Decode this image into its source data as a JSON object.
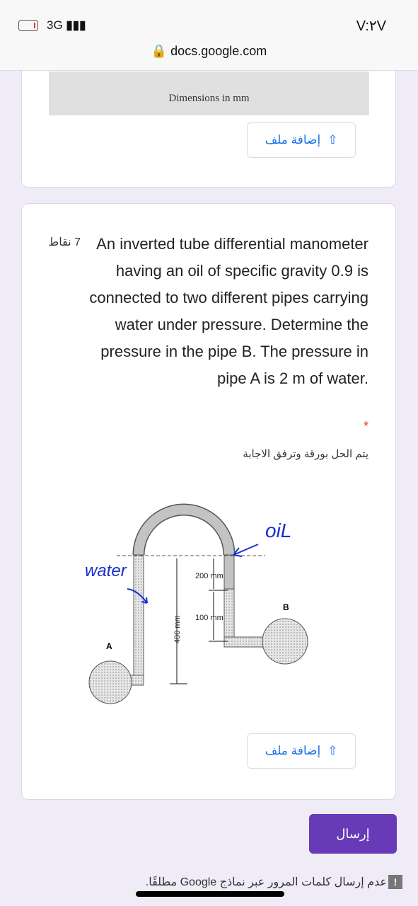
{
  "status_bar": {
    "network": "3G",
    "signal_icon": "signal-bars-icon",
    "battery_icon": "battery-low-icon",
    "time": "V:٢V"
  },
  "browser": {
    "url": "docs.google.com",
    "lock_icon": "lock-icon"
  },
  "prev_card": {
    "image_caption": "Dimensions in mm",
    "upload_label": "إضافة ملف"
  },
  "question_card": {
    "points": "7 نقاط",
    "question": "An inverted tube differential manometer having an oil of specific gravity 0.9 is connected to two different pipes carrying water under pressure. Determine the pressure in the pipe B. The pressure in pipe A is 2 m of water.",
    "required_mark": "*",
    "description": "يتم الحل بورقة وترفق الاجابة",
    "diagram": {
      "label_water": "water",
      "label_oil": "oiL",
      "label_a": "A",
      "label_b": "B",
      "dim_200": "200 mm",
      "dim_100": "100 mm",
      "dim_400": "400 mm"
    },
    "upload_label": "إضافة ملف"
  },
  "submit_label": "إرسال",
  "warning": "عدم إرسال كلمات المرور عبر نماذج Google مطلقًا.",
  "colors": {
    "accent": "#673ab7",
    "link": "#1a73e8",
    "background": "#efebf7"
  }
}
